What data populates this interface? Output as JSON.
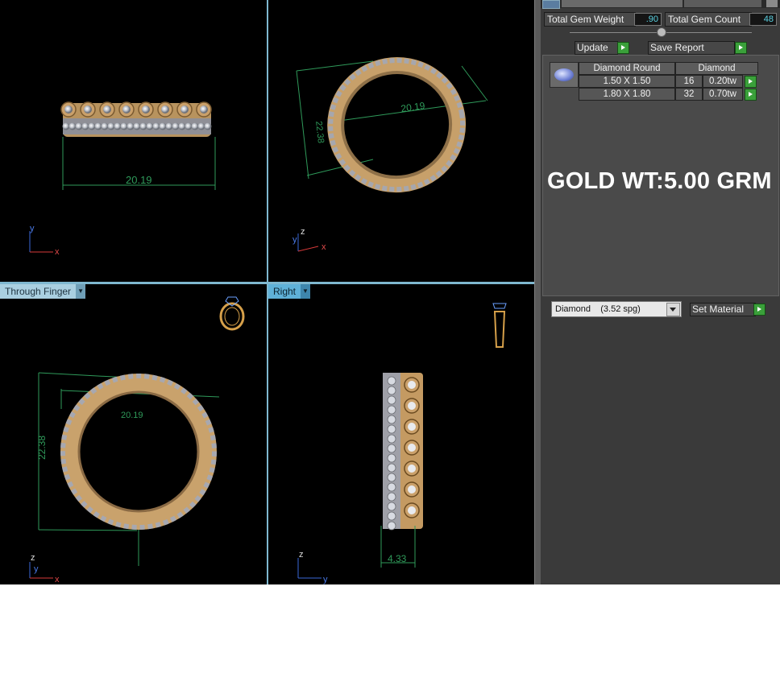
{
  "viewports": {
    "top_left": {
      "dimension": "20.19",
      "axis": [
        "y",
        "x"
      ]
    },
    "top_right": {
      "dimension_width": "20.19",
      "dimension_height": "22.38",
      "axis": [
        "z",
        "y",
        "x"
      ]
    },
    "bottom_left": {
      "label": "Through Finger",
      "dimension_width": "20.19",
      "dimension_height": "22.38",
      "axis": [
        "z",
        "y",
        "x"
      ]
    },
    "bottom_right": {
      "label": "Right",
      "dimension": "4.33",
      "axis": [
        "z",
        "y"
      ]
    }
  },
  "panel": {
    "total_gem_weight_label": "Total Gem Weight",
    "total_gem_weight_value": ".90",
    "total_gem_count_label": "Total Gem Count",
    "total_gem_count_value": "48",
    "update_label": "Update",
    "save_report_label": "Save Report",
    "table": {
      "header_shape": "Diamond Round",
      "header_material": "Diamond",
      "rows": [
        {
          "size": "1.50 X 1.50",
          "count": "16",
          "weight": "0.20tw"
        },
        {
          "size": "1.80 X 1.80",
          "count": "32",
          "weight": "0.70tw"
        }
      ]
    },
    "gold_weight": "GOLD WT:5.00 GRM",
    "material_select": "Diamond    (3.52 spg)",
    "set_material_label": "Set Material"
  },
  "colors": {
    "viewport_bg": "#000000",
    "dimension_line": "#2f9a5a",
    "gold": "#d9a86a",
    "accent_green": "#3aa03a",
    "value_cyan": "#5ad0e0"
  },
  "icons": [
    "ring-orientation-icon",
    "gem-icon",
    "go-arrow-icon",
    "dropdown-arrow-icon"
  ]
}
